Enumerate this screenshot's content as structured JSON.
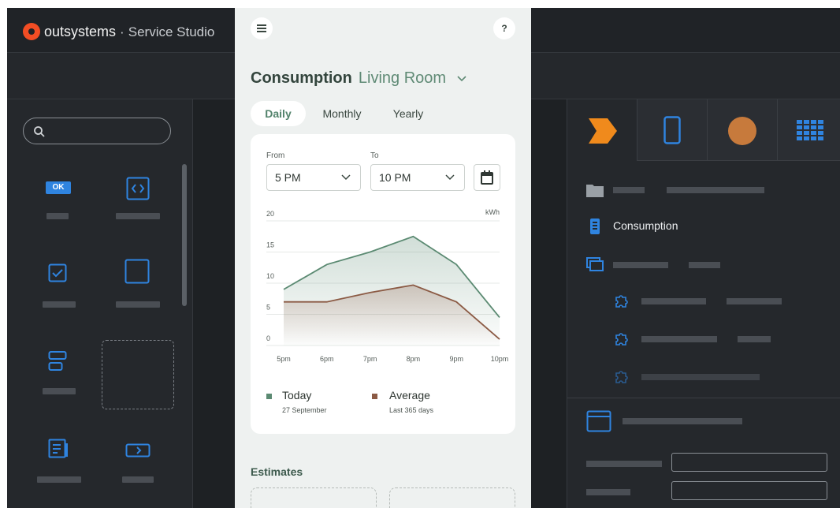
{
  "app": {
    "brand_name": "outsystems",
    "separator": "·",
    "product": "Service Studio"
  },
  "toolbox": {
    "search_placeholder": "",
    "ok_badge": "OK"
  },
  "right_panel": {
    "tabs": [
      "process-icon",
      "mobile-icon",
      "theme-icon",
      "grid-icon"
    ],
    "tree_screen_label": "Consumption"
  },
  "screen": {
    "title": "Consumption",
    "room": "Living Room",
    "tabs": [
      "Daily",
      "Monthly",
      "Yearly"
    ],
    "active_tab": "Daily",
    "from_label": "From",
    "to_label": "To",
    "from_value": "5 PM",
    "to_value": "10 PM",
    "estimates_label": "Estimates"
  },
  "colors": {
    "accent_green": "#5f8a75",
    "today_line": "#5b8a72",
    "average_line": "#8b5a44",
    "brand_red": "#f24d24",
    "orange": "#f08a1c",
    "blue": "#2f84e0"
  },
  "chart_data": {
    "type": "area",
    "unit_label": "kWh",
    "categories": [
      "5pm",
      "6pm",
      "7pm",
      "8pm",
      "9pm",
      "10pm"
    ],
    "x": [
      5,
      6,
      7,
      8,
      9,
      10
    ],
    "ylim": [
      0,
      20
    ],
    "yticks": [
      "20",
      "15",
      "10",
      "5",
      "0"
    ],
    "series": [
      {
        "name": "Today",
        "x": [
          5,
          5.6,
          6.5,
          7.4,
          8.2,
          9.0
        ],
        "values": [
          9,
          13,
          15,
          17.5,
          13,
          4.5
        ],
        "full_x": [
          5,
          5.6,
          6.5,
          7.4,
          8.2,
          9.0,
          9.9
        ],
        "full_values": [
          8.5,
          12.8,
          15.0,
          17.5,
          12.8,
          4.3
        ]
      },
      {
        "name": "Average",
        "values": [
          7,
          7,
          8.5,
          9.7,
          7,
          1
        ]
      }
    ],
    "legend": [
      {
        "name": "Today",
        "sub": "27 September"
      },
      {
        "name": "Average",
        "sub": "Last 365 days"
      }
    ],
    "grid": true
  }
}
